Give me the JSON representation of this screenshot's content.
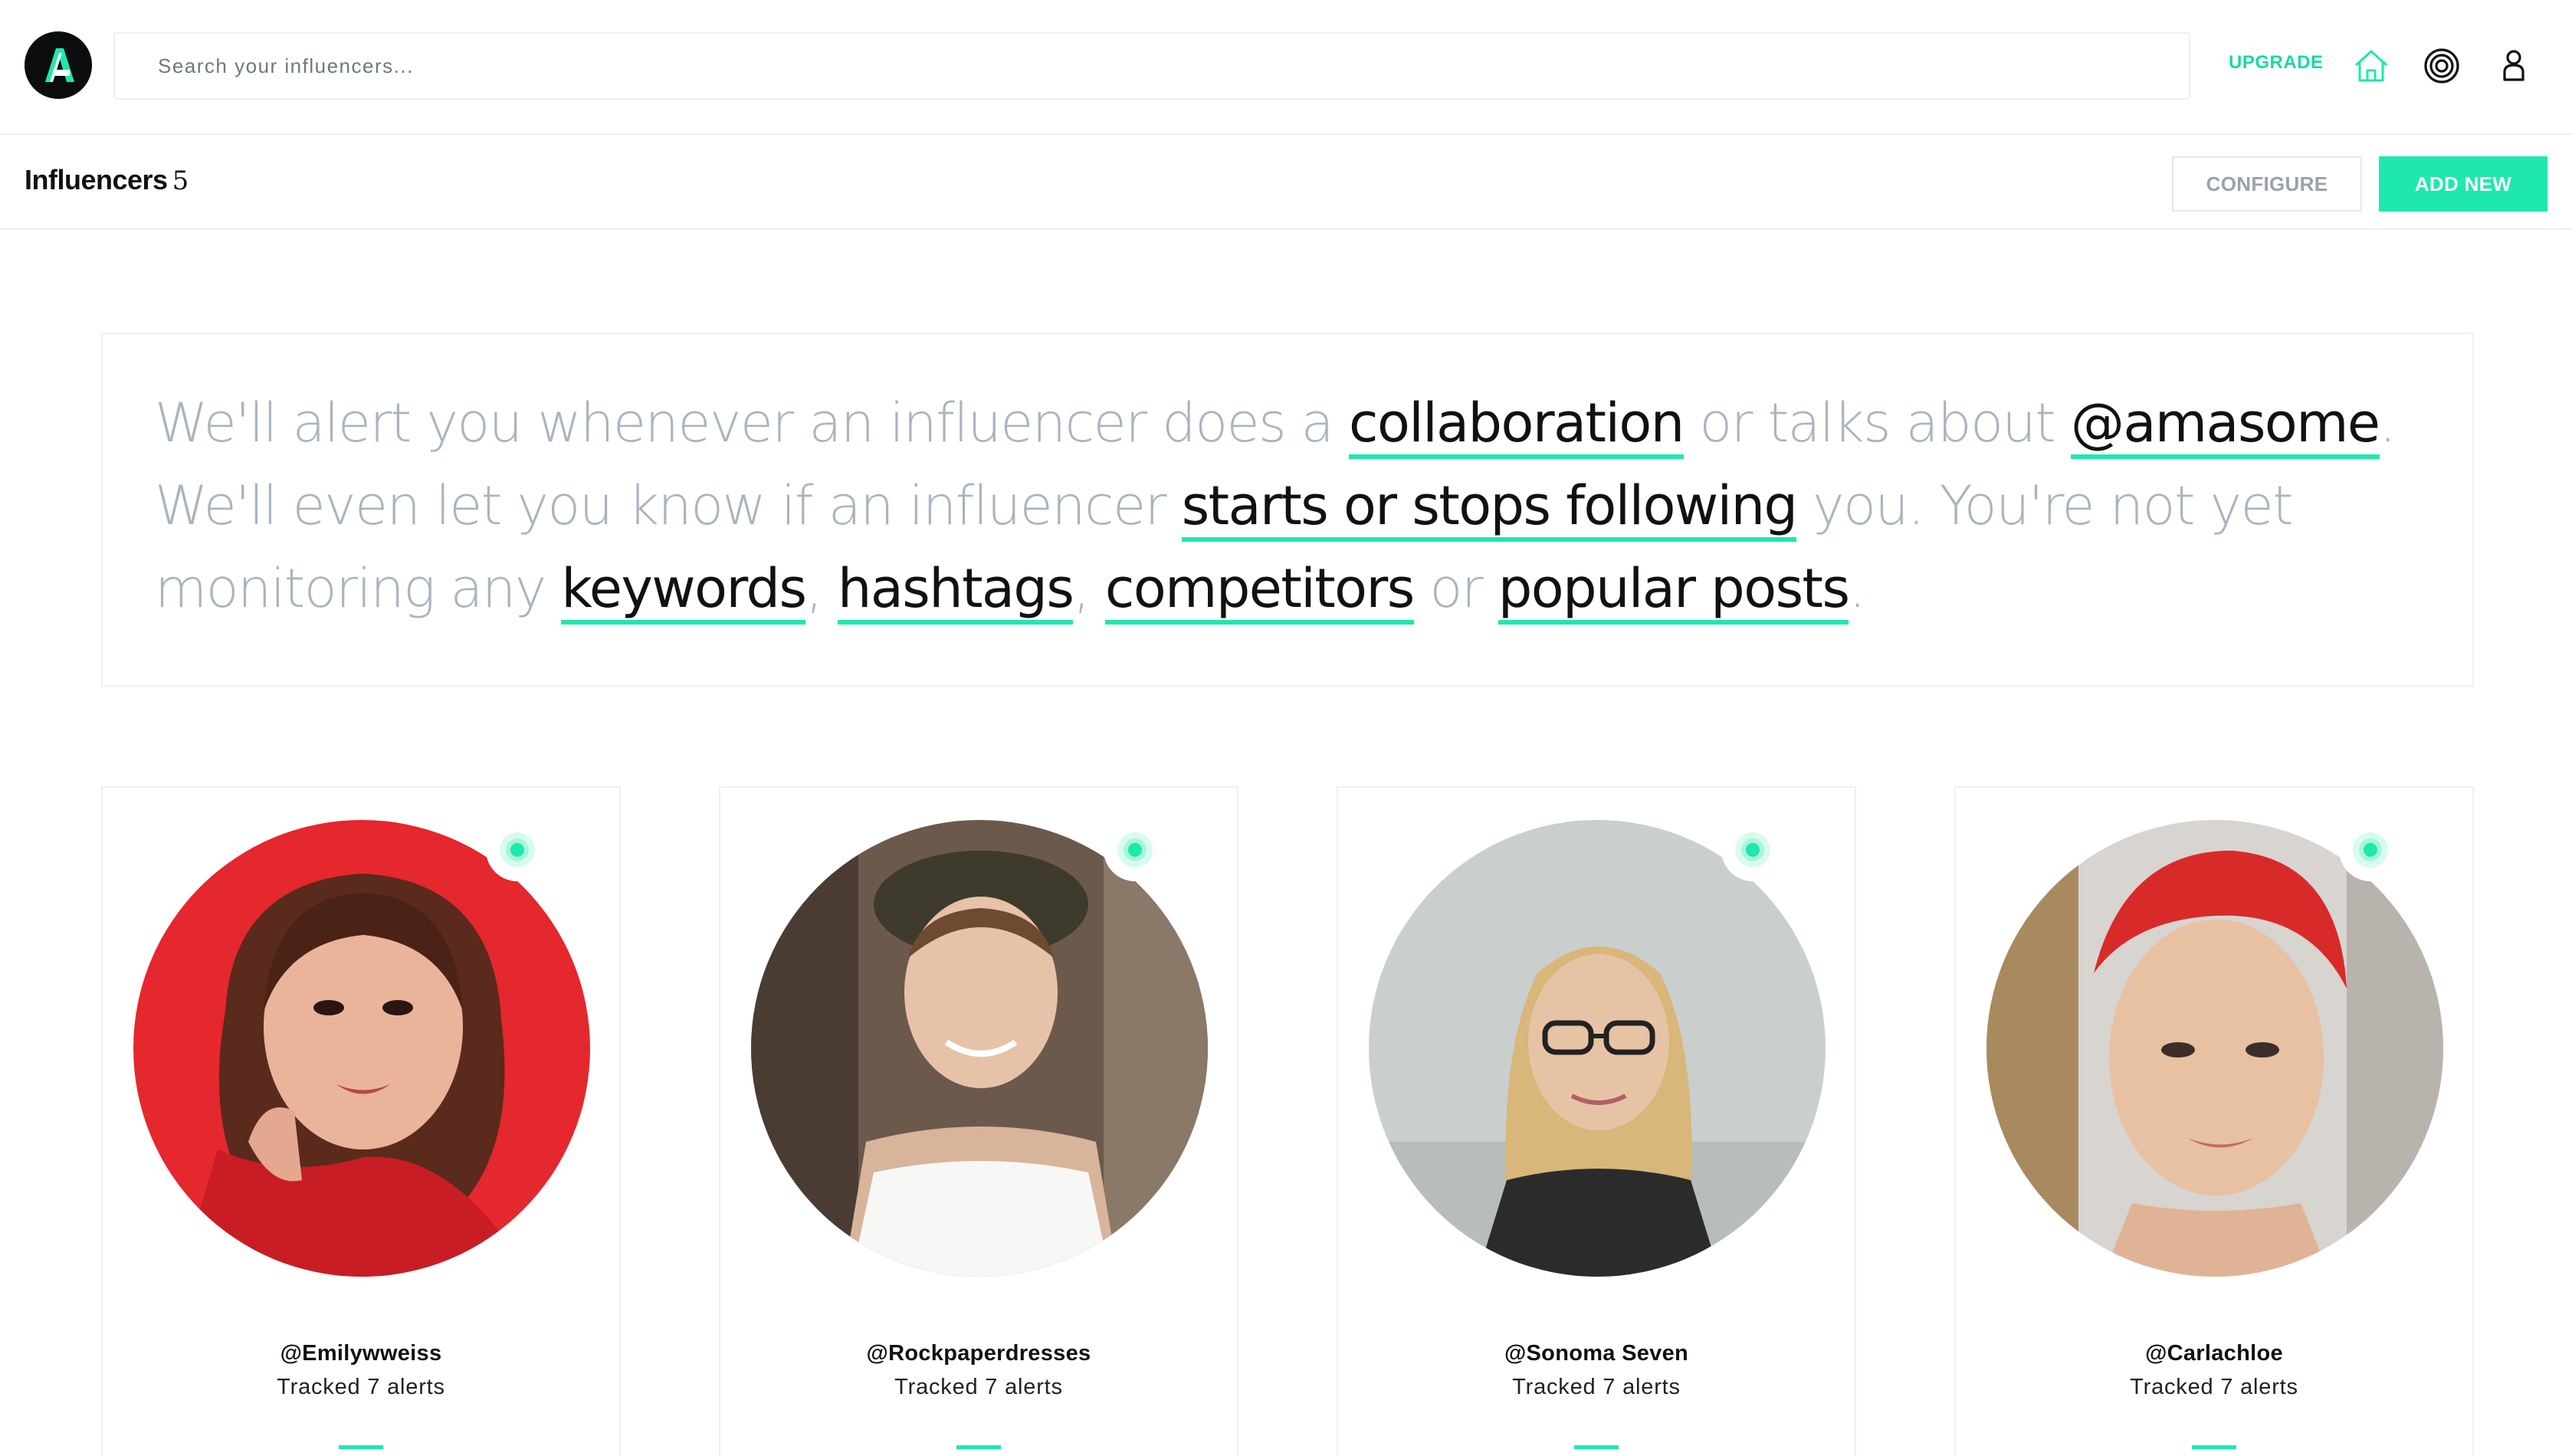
{
  "header": {
    "logo_letter": "A",
    "search_placeholder": "Search your influencers...",
    "upgrade_label": "UPGRADE",
    "icons": [
      "home-icon",
      "target-icon",
      "user-icon"
    ]
  },
  "page": {
    "title": "Influencers",
    "count": "5",
    "configure_label": "CONFIGURE",
    "add_new_label": "ADD NEW"
  },
  "info": {
    "t1": "We'll alert you whenever an influencer does a ",
    "link_collaboration": "collaboration",
    "t2": " or talks about ",
    "link_mention": "@amasome",
    "t3": ". We'll even let you know if an influencer ",
    "link_following": "starts or stops following",
    "t4": " you. You're not yet monitoring any ",
    "link_keywords": "keywords",
    "t5": ", ",
    "link_hashtags": "hashtags",
    "t6": ", ",
    "link_competitors": "competitors",
    "t7": " or ",
    "link_popular": "popular posts",
    "t8": "."
  },
  "influencers": [
    {
      "handle": "@Emilywweiss",
      "tracked": "Tracked 7 alerts"
    },
    {
      "handle": "@Rockpaperdresses",
      "tracked": "Tracked 7 alerts"
    },
    {
      "handle": "@Sonoma Seven",
      "tracked": "Tracked 7 alerts"
    },
    {
      "handle": "@Carlachloe",
      "tracked": "Tracked 7 alerts"
    }
  ],
  "colors": {
    "accent": "#1ee8ad",
    "upgrade": "#19d9a0",
    "muted_text": "#a9b4bf",
    "logo_bg": "#0c0d0f"
  }
}
